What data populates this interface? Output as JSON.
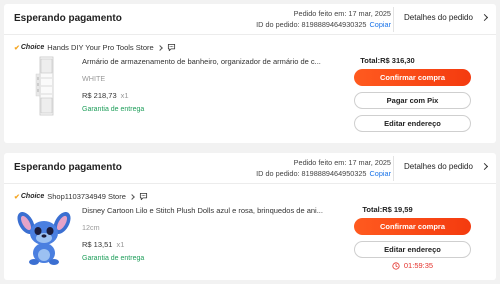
{
  "orders": [
    {
      "status": "Esperando pagamento",
      "date_text": "Pedido feito em: 17 mar, 2025",
      "id_text": "ID do pedido: 8198889464930325",
      "copy_label": "Copiar",
      "details_label": "Detalhes do pedido",
      "choice_label": "Choice",
      "store_name": "Hands DIY Your Pro Tools Store",
      "product_title": "Armário de armazenamento de banheiro, organizador de armário de c...",
      "variant": "WHITE",
      "price": "R$ 218,73",
      "qty": "x1",
      "guarantee": "Garantia de entrega",
      "total": "Total:R$ 316,30",
      "buttons": [
        "Confirmar compra",
        "Pagar com Pix",
        "Editar endereço"
      ]
    },
    {
      "status": "Esperando pagamento",
      "date_text": "Pedido feito em: 17 mar, 2025",
      "id_text": "ID do pedido: 8198889464950325",
      "copy_label": "Copiar",
      "details_label": "Detalhes do pedido",
      "choice_label": "Choice",
      "store_name": "Shop1103734949 Store",
      "product_title": "Disney Cartoon Lilo e Stitch Plush Dolls azul e rosa, brinquedos de ani...",
      "variant": "12cm",
      "price": "R$ 13,51",
      "qty": "x1",
      "guarantee": "Garantia de entrega",
      "total": "Total:R$ 19,59",
      "buttons": [
        "Confirmar compra",
        "Editar endereço"
      ],
      "timer": "01:59:35"
    }
  ],
  "colors": {
    "accent": "#f44412",
    "link": "#1a73e8",
    "guarantee": "#1e9e5a",
    "timer": "#e4312b",
    "choice_check": "#f5a623"
  },
  "icons": [
    "chat-bubble-icon",
    "chevron-right-icon",
    "clock-icon",
    "checkmark-icon"
  ]
}
